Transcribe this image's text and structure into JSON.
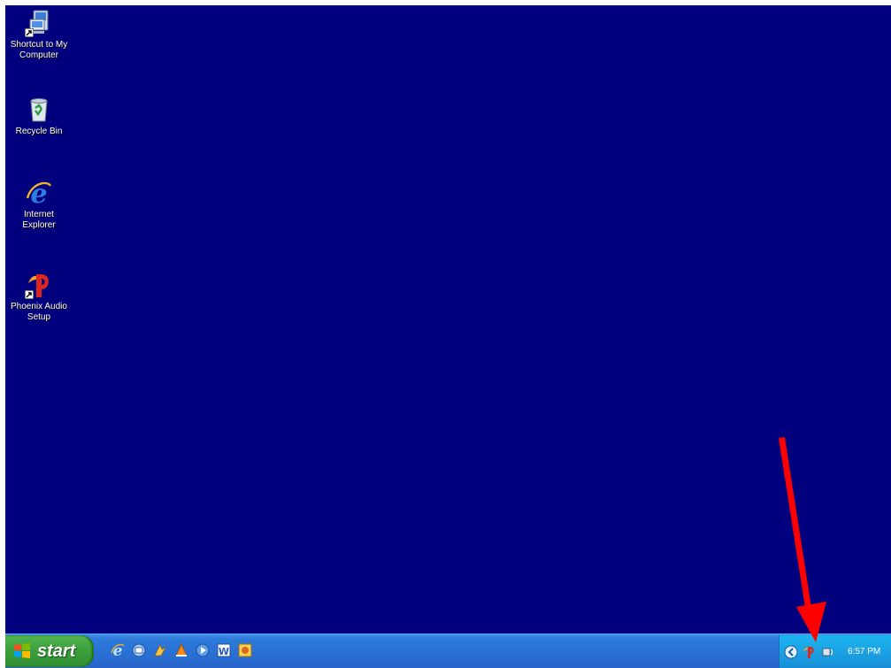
{
  "desktop": {
    "background_color": "#00007f",
    "icons": [
      {
        "label": "Shortcut to My\nComputer",
        "icon": "my-computer-icon"
      },
      {
        "label": "Recycle Bin",
        "icon": "recycle-bin-icon"
      },
      {
        "label": "Internet\nExplorer",
        "icon": "internet-explorer-icon"
      },
      {
        "label": "Phoenix Audio\nSetup",
        "icon": "phoenix-audio-icon"
      }
    ]
  },
  "taskbar": {
    "start_label": "start",
    "quick_launch": [
      "internet-explorer-icon",
      "outlook-express-icon",
      "media-icon",
      "vlc-icon",
      "windows-media-player-icon",
      "word-icon",
      "app-icon"
    ],
    "tray": {
      "icons": [
        "expand-tray-icon",
        "phoenix-audio-tray-icon",
        "volume-icon"
      ],
      "clock": "6:57 PM"
    }
  },
  "annotation": {
    "arrow_color": "#ff0000",
    "points_to": "phoenix-audio-tray-icon"
  }
}
